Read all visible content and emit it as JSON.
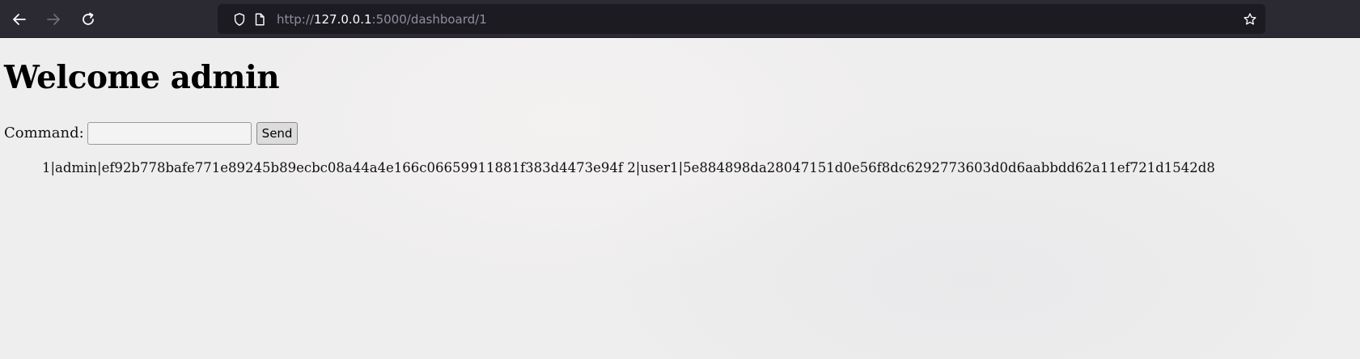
{
  "browser": {
    "url_prefix": "http://",
    "url_host": "127.0.0.1",
    "url_path": ":5000/dashboard/1",
    "icons": {
      "back": "arrow-left-icon",
      "forward": "arrow-right-icon",
      "reload": "reload-icon",
      "shield": "shield-icon",
      "page": "page-icon",
      "bookmark": "star-icon"
    }
  },
  "page": {
    "heading": "Welcome admin",
    "command_label": "Command:",
    "command_value": "",
    "send_label": "Send",
    "result": "1|admin|ef92b778bafe771e89245b89ecbc08a44a4e166c06659911881f383d4473e94f 2|user1|5e884898da28047151d0e56f8dc6292773603d0d6aabbdd62a11ef721d1542d8"
  },
  "colors": {
    "toolbar_bg": "#2b2a33",
    "urlbar_bg": "#1c1b22",
    "page_bg": "#efeeee"
  }
}
